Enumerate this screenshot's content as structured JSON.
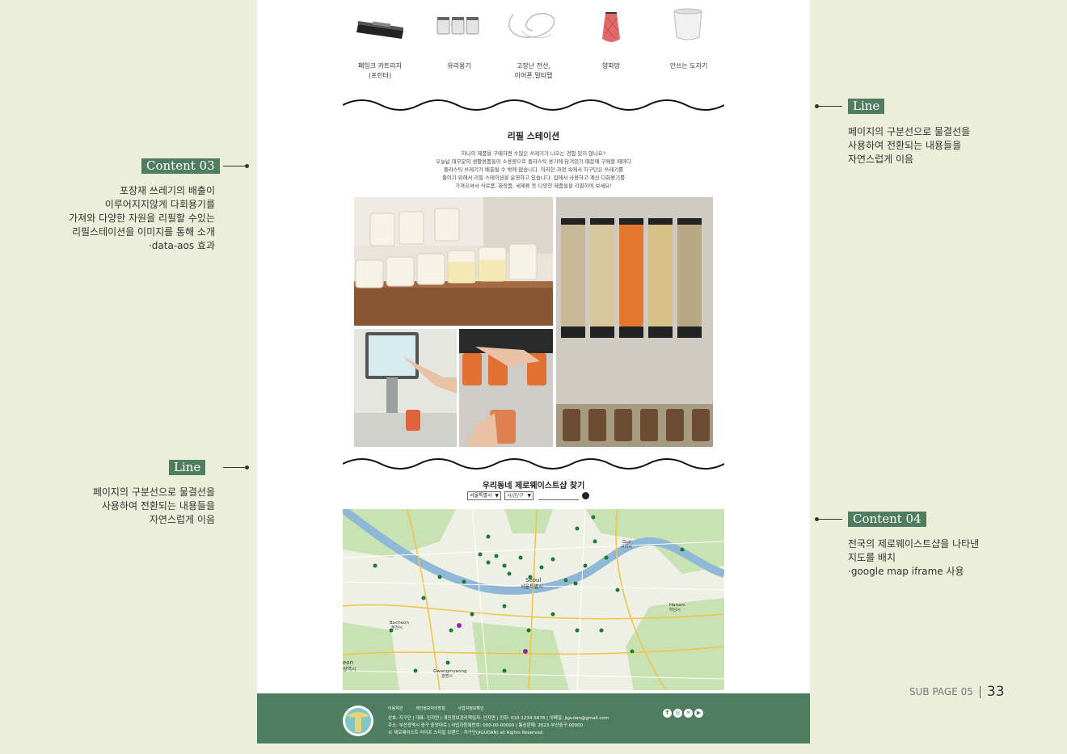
{
  "annotations": {
    "content03": {
      "tag": "Content 03",
      "lines": [
        "포장재 쓰레기의 배출이",
        "이루어지지않게 다회용기를",
        "가져와 다양한 자원을 리필할 수있는",
        "리필스테이션을 이미지를 통해 소개",
        "·data-aos 효과"
      ]
    },
    "line_left": {
      "tag": "Line",
      "lines": [
        "페이지의 구분선으로  물결선을",
        "사용하여 전환되는 내용들을",
        "자연스럽게 이음"
      ]
    },
    "line_right": {
      "tag": "Line",
      "lines": [
        "페이지의 구분선으로  물결선을",
        "사용하여 전환되는 내용들을",
        "자연스럽게 이음"
      ]
    },
    "content04": {
      "tag": "Content 04",
      "lines": [
        "전국의 제로웨이스트샵을 나타낸",
        "지도를 배치",
        "·google map iframe 사용"
      ]
    }
  },
  "products": [
    {
      "icon": "toner-cartridge-icon",
      "lines": [
        "폐잉크 카트리지",
        "(프린터)"
      ]
    },
    {
      "icon": "glass-jar-icon",
      "lines": [
        "유리용기"
      ]
    },
    {
      "icon": "cable-earphone-icon",
      "lines": [
        "고장난 전선,",
        "이어폰,멀티탭"
      ]
    },
    {
      "icon": "onion-net-icon",
      "lines": [
        "양파망"
      ]
    },
    {
      "icon": "ceramic-bowl-icon",
      "lines": [
        "안쓰는 도자기"
      ]
    }
  ],
  "refill": {
    "title": "리필 스테이션",
    "desc": [
      "하나의 제품을 구매하면 수많은 쓰레기가 나오는 경험 있지 않나요?",
      "오늘날 대부분의 생활용품들이 소용량으로 플라스틱 용기에 담겨있기 때문에 구매할 때마다",
      "플라스틱 쓰레기가 배출될 수 밖에 없습니다. 이러한 과정 속에서 지구단은 쓰레기를",
      "줄이기 위해서 리필 스테이션을 운영하고 있습니다. 집에서 사용하고 계신 다회용기를",
      "가져오셔서 식료품, 화장품, 세제류 등 다양한 제품들을 리필하여 보세요!"
    ]
  },
  "find": {
    "title": "우리동네 제로웨이스트샵 찾기",
    "city_select": "서울특별시",
    "district_select": "시/군/구"
  },
  "map": {
    "labels": {
      "seoul": "Seoul",
      "seoul_ko": "서울특별시",
      "guri": "Guri",
      "guri_ko": "구리시",
      "hanam": "Hanam",
      "hanam_ko": "하남시",
      "bucheon": "Bucheon",
      "bucheon_ko": "부천시",
      "gwangmyeong": "Gwangmyeong",
      "gwangmyeong_ko": "광명시",
      "incheon_partial": "eon",
      "incheon_ko_partial": "광역시"
    }
  },
  "footer": {
    "links": [
      "이용약관",
      "개인정보처리방침",
      "사업자정보확인"
    ],
    "info": [
      "상호: 지구단 | 대표: 인지연 | 개인정보관리책임자: 인지연 | 전화: 010-1234-5678 | 이메일: jigudan@gmail.com",
      "주소: 부산광역시 중구 중앙대로 | 사업자등록번호: 000-00-00000 | 통신판매: 2023-부산중구-00000",
      "© 제로웨이스트 라이프 스타일 브랜드 : 지구단(JIGUDAN) all Rights Reserved."
    ],
    "sns": [
      "facebook-icon",
      "instagram-icon",
      "x-icon",
      "youtube-icon"
    ]
  },
  "page_number": {
    "sub": "SUB PAGE 05",
    "num": "33"
  },
  "colors": {
    "background": "#ebeed9",
    "accent": "#4e7d5f",
    "page": "#ffffff"
  }
}
